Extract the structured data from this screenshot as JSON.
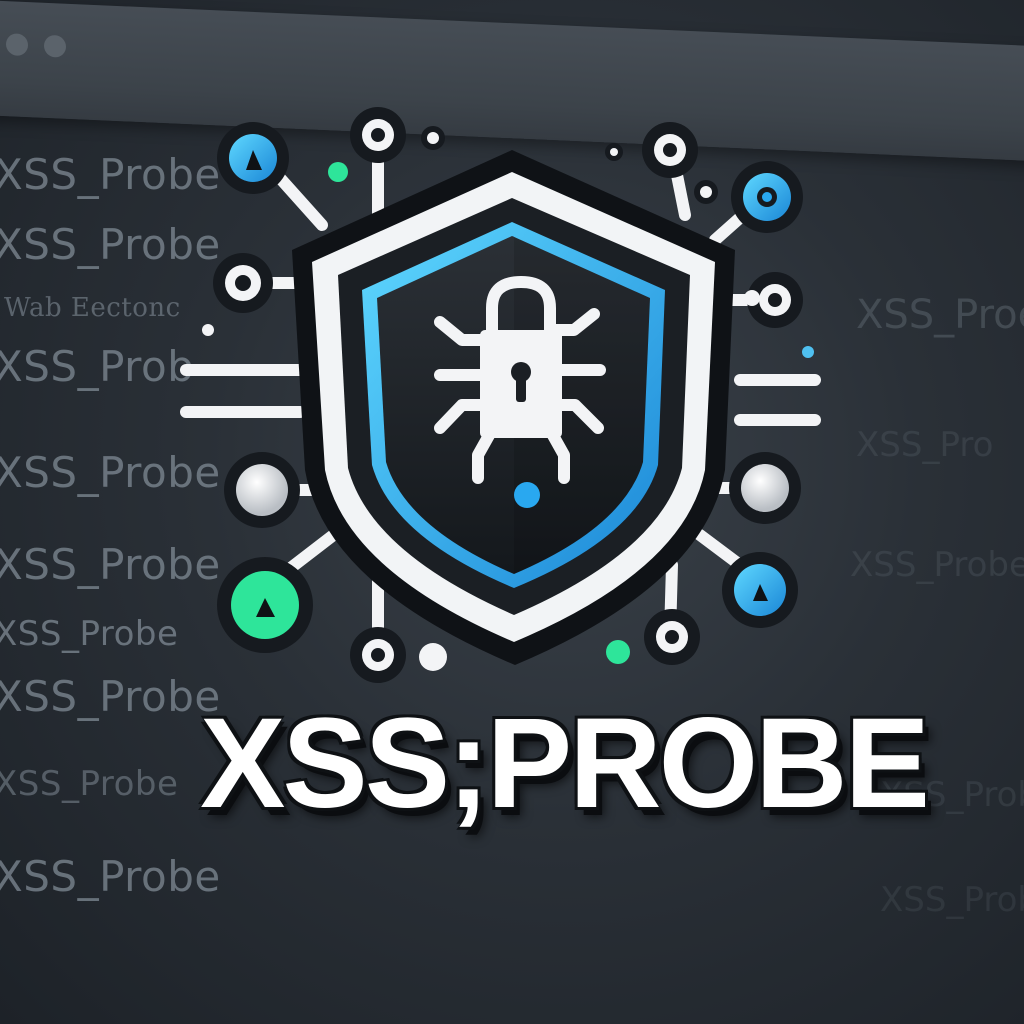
{
  "background_lines": [
    "XSS_Probe",
    "XSS_Probe",
    "Wab Eectonc",
    "XSS_Prob",
    "XSS_Probe",
    "XSS_Probe",
    "XSS_Probe",
    "XSS_Probe",
    "XSS_Probe",
    "XSS_Probe"
  ],
  "right_lines": [
    "XSS_Proe",
    "XSS_Pro",
    "XSS_Probe",
    "XSS_Prob",
    "XSS_Probe"
  ],
  "wordmark": "XSS;PROBE",
  "colors": {
    "cyan": "#29a8f0",
    "green": "#2ee59a",
    "shield_dark": "#1c2127",
    "shield_white": "#f2f4f6"
  },
  "icons": [
    "shield-icon",
    "padlock-icon",
    "bug-icon",
    "circuit-node-icon"
  ]
}
